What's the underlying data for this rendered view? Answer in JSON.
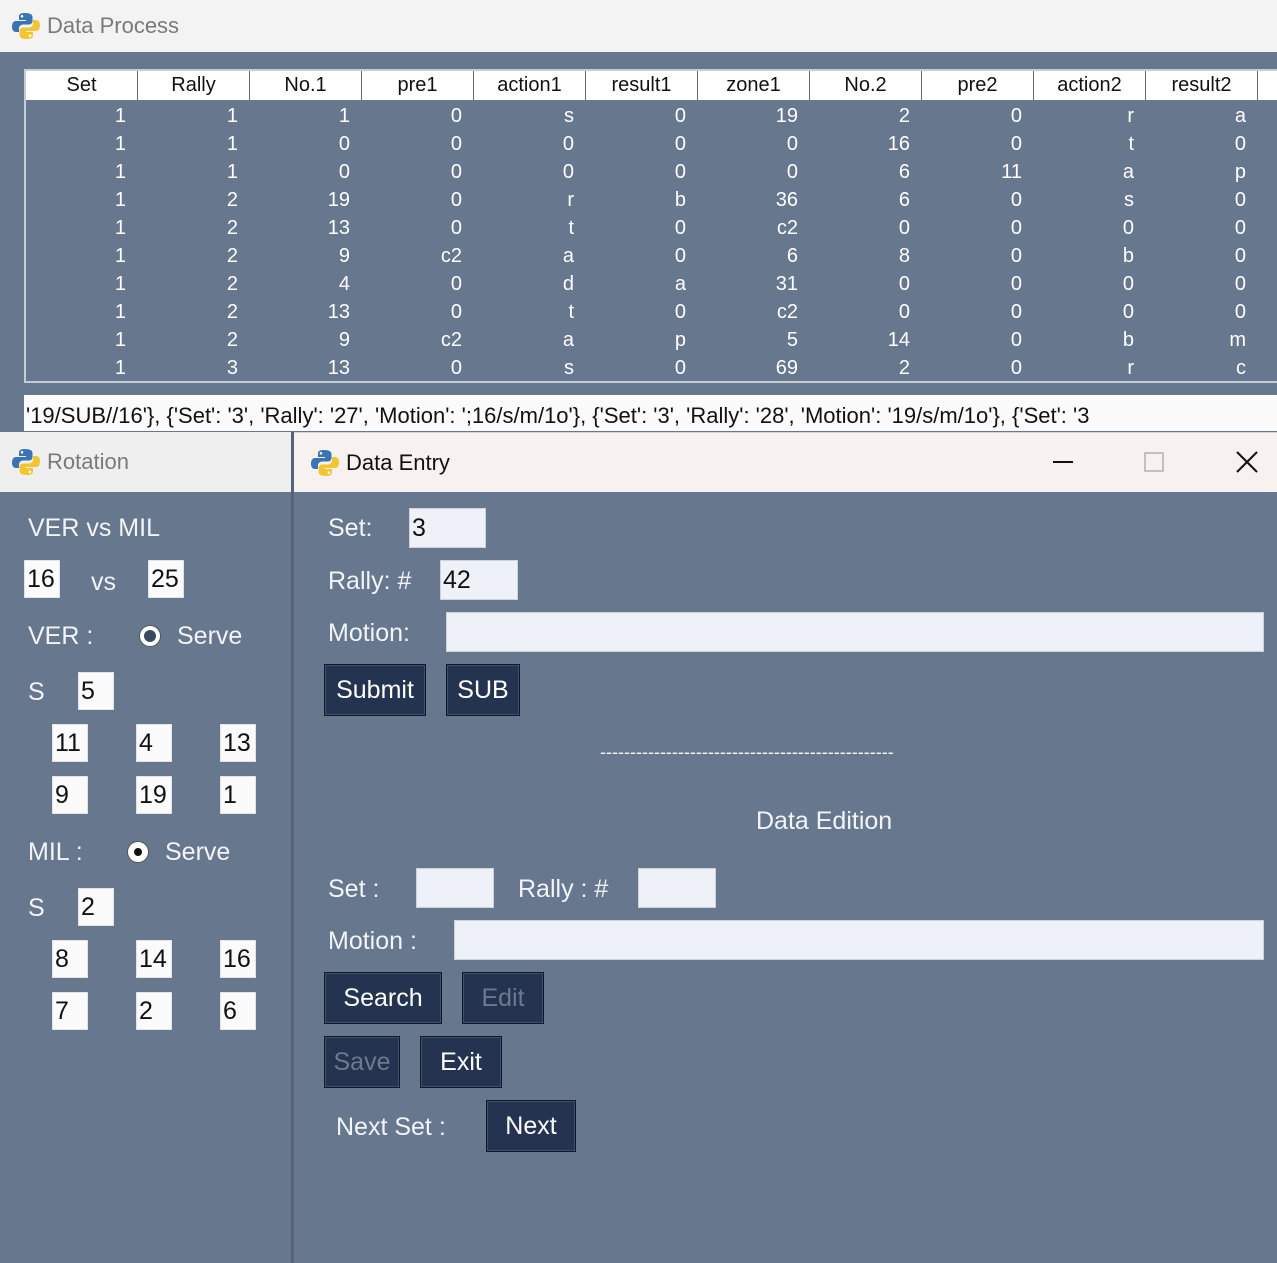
{
  "data_process": {
    "title": "Data Process",
    "columns": [
      "Set",
      "Rally",
      "No.1",
      "pre1",
      "action1",
      "result1",
      "zone1",
      "No.2",
      "pre2",
      "action2",
      "result2"
    ],
    "rows": [
      [
        "1",
        "1",
        "1",
        "0",
        "s",
        "0",
        "19",
        "2",
        "0",
        "r",
        "a"
      ],
      [
        "1",
        "1",
        "0",
        "0",
        "0",
        "0",
        "0",
        "16",
        "0",
        "t",
        "0"
      ],
      [
        "1",
        "1",
        "0",
        "0",
        "0",
        "0",
        "0",
        "6",
        "11",
        "a",
        "p"
      ],
      [
        "1",
        "2",
        "19",
        "0",
        "r",
        "b",
        "36",
        "6",
        "0",
        "s",
        "0"
      ],
      [
        "1",
        "2",
        "13",
        "0",
        "t",
        "0",
        "c2",
        "0",
        "0",
        "0",
        "0"
      ],
      [
        "1",
        "2",
        "9",
        "c2",
        "a",
        "0",
        "6",
        "8",
        "0",
        "b",
        "0"
      ],
      [
        "1",
        "2",
        "4",
        "0",
        "d",
        "a",
        "31",
        "0",
        "0",
        "0",
        "0"
      ],
      [
        "1",
        "2",
        "13",
        "0",
        "t",
        "0",
        "c2",
        "0",
        "0",
        "0",
        "0"
      ],
      [
        "1",
        "2",
        "9",
        "c2",
        "a",
        "p",
        "5",
        "14",
        "0",
        "b",
        "m"
      ],
      [
        "1",
        "3",
        "13",
        "0",
        "s",
        "0",
        "69",
        "2",
        "0",
        "r",
        "c"
      ]
    ],
    "log_text": "'19/SUB//16'}, {'Set': '3', 'Rally': '27', 'Motion': ';16/s/m/1o'}, {'Set': '3', 'Rally': '28', 'Motion': '19/s/m/1o'}, {'Set': '3"
  },
  "rotation": {
    "title": "Rotation",
    "match": "VER vs MIL",
    "score_home": "16",
    "vs_label": "vs",
    "score_away": "25",
    "team_a": {
      "label": "VER :",
      "serve_label": "Serve",
      "setter_label": "S",
      "setter": "5",
      "positions": [
        "11",
        "4",
        "13",
        "9",
        "19",
        "1"
      ]
    },
    "team_b": {
      "label": "MIL :",
      "serve_label": "Serve",
      "setter_label": "S",
      "setter": "2",
      "positions": [
        "8",
        "14",
        "16",
        "7",
        "2",
        "6"
      ]
    }
  },
  "data_entry": {
    "title": "Data Entry",
    "set_label": "Set:",
    "set_value": "3",
    "rally_label": "Rally: #",
    "rally_value": "42",
    "motion_label": "Motion:",
    "motion_value": "",
    "submit_label": "Submit",
    "sub_label": "SUB",
    "separator": "-------------------------------------------------",
    "edition_title": "Data Edition",
    "edit_set_label": "Set :",
    "edit_set_value": "",
    "edit_rally_label": "Rally : #",
    "edit_rally_value": "",
    "edit_motion_label": "Motion :",
    "edit_motion_value": "",
    "search_label": "Search",
    "edit_label": "Edit",
    "save_label": "Save",
    "exit_label": "Exit",
    "next_set_label": "Next Set :",
    "next_label": "Next"
  },
  "colors": {
    "background": "#66778e",
    "button": "#24334f",
    "entry": "#eef2f8"
  },
  "icons": [
    "python-icon",
    "minimize-icon",
    "maximize-icon",
    "close-icon"
  ]
}
